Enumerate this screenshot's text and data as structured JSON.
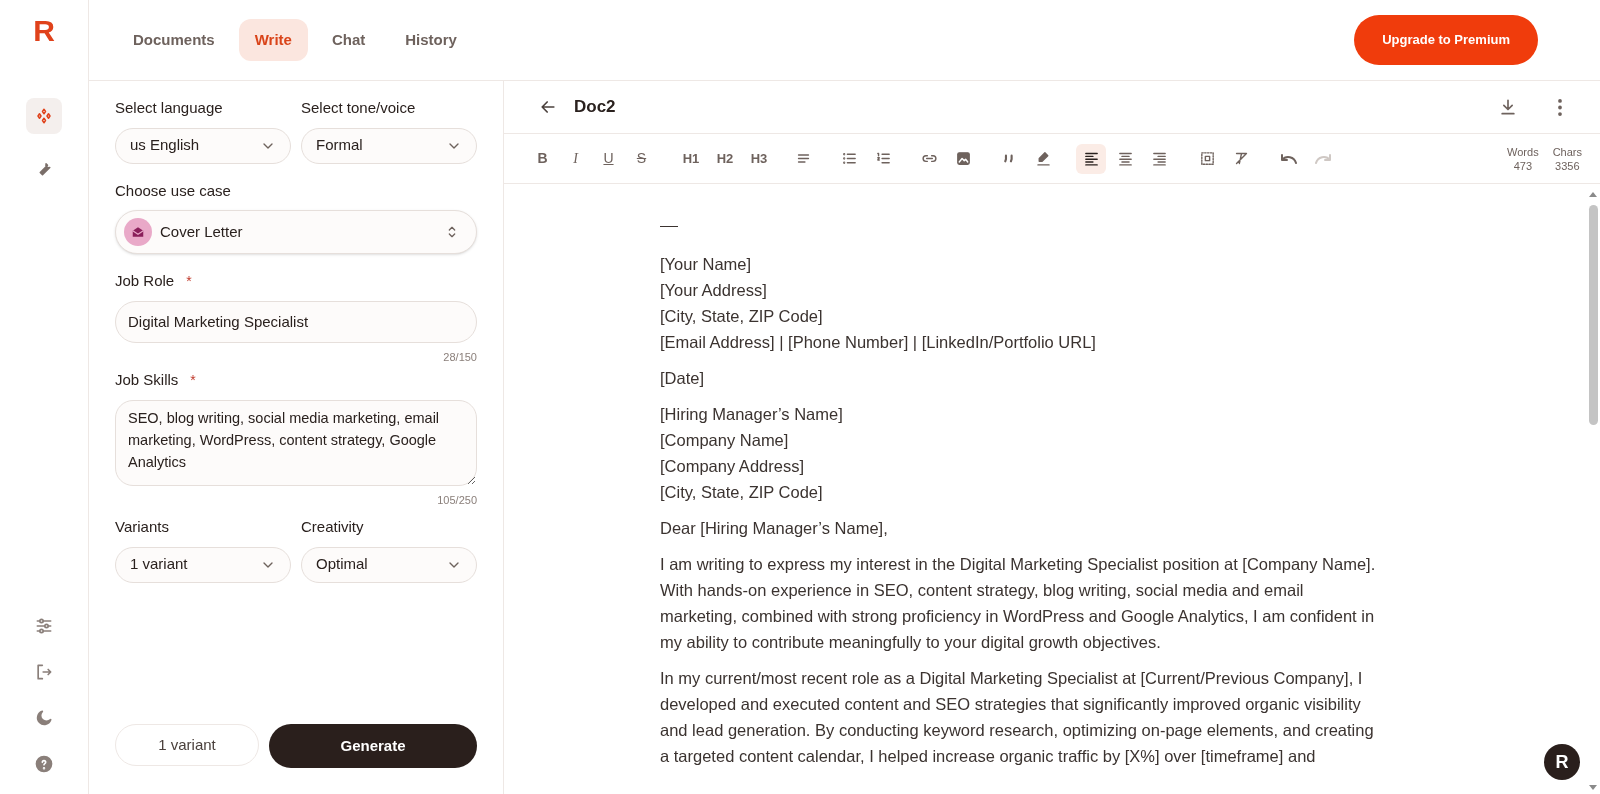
{
  "logo": {
    "text": "R"
  },
  "rail": {
    "items": [
      {
        "selected": true
      },
      {
        "selected": false
      }
    ]
  },
  "tabs": [
    {
      "label": "Documents",
      "selected": false
    },
    {
      "label": "Write",
      "selected": true
    },
    {
      "label": "Chat",
      "selected": false
    },
    {
      "label": "History",
      "selected": false
    }
  ],
  "upgrade_button": "Upgrade to Premium",
  "form": {
    "language": {
      "label": "Select language",
      "value": "us English"
    },
    "tone": {
      "label": "Select tone/voice",
      "value": "Formal"
    },
    "use_case": {
      "label": "Choose use case",
      "value": "Cover Letter"
    },
    "required_mark": "*",
    "job_role": {
      "label": "Job Role",
      "required": true,
      "value": "Digital Marketing Specialist",
      "counter": "28/150"
    },
    "job_skills": {
      "label": "Job Skills",
      "required": true,
      "value": "SEO, blog writing, social media marketing, email marketing, WordPress, content strategy, Google Analytics",
      "counter": "105/250"
    },
    "variants": {
      "label": "Variants",
      "value": "1 variant"
    },
    "creativity": {
      "label": "Creativity",
      "value": "Optimal"
    },
    "variant_button": "1 variant",
    "generate_button": "Generate"
  },
  "editor": {
    "title": "Doc2",
    "format_buttons": [
      "B",
      "I",
      "U",
      "S"
    ],
    "heading_buttons": [
      "H1",
      "H2",
      "H3"
    ],
    "tool_icons": [
      {
        "selected": false,
        "disabled": false
      },
      {
        "selected": false,
        "disabled": false
      },
      {
        "selected": false,
        "disabled": false
      },
      {
        "selected": false,
        "disabled": false
      },
      {
        "selected": false,
        "disabled": false
      },
      {
        "selected": false,
        "disabled": false
      },
      {
        "selected": false,
        "disabled": false
      },
      {
        "selected": true,
        "disabled": false
      },
      {
        "selected": false,
        "disabled": false
      },
      {
        "selected": false,
        "disabled": false
      },
      {
        "selected": false,
        "disabled": false
      },
      {
        "selected": false,
        "disabled": false
      },
      {
        "selected": false,
        "disabled": false
      },
      {
        "selected": false,
        "disabled": true
      }
    ],
    "stats": [
      {
        "label": "Words",
        "value": "473"
      },
      {
        "label": "Chars",
        "value": "3356"
      }
    ],
    "blocks": [
      {
        "kind": "rule"
      },
      {
        "kind": "lines",
        "lines": [
          "[Your Name]",
          "[Your Address]",
          "[City, State, ZIP Code]",
          "[Email Address] | [Phone Number] | [LinkedIn/Portfolio URL]"
        ]
      },
      {
        "kind": "lines",
        "lines": [
          "[Date]"
        ]
      },
      {
        "kind": "lines",
        "lines": [
          "[Hiring Manager’s Name]",
          "[Company Name]",
          "[Company Address]",
          "[City, State, ZIP Code]"
        ]
      },
      {
        "kind": "lines",
        "lines": [
          "Dear [Hiring Manager’s Name],"
        ]
      },
      {
        "kind": "lines",
        "lines": [
          "I am writing to express my interest in the Digital Marketing Specialist position at [Company Name].",
          "With hands-on experience in SEO, content strategy, blog writing, social media and email",
          "marketing, combined with strong proficiency in WordPress and Google Analytics, I am confident in",
          "my ability to contribute meaningfully to your digital growth objectives."
        ]
      },
      {
        "kind": "lines",
        "lines": [
          "In my current/most recent role as a Digital Marketing Specialist at [Current/Previous Company], I",
          "developed and executed content and SEO strategies that significantly improved organic visibility",
          "and lead generation. By conducting keyword research, optimizing on-page elements, and creating",
          "a targeted content calendar, I helped increase organic traffic by [X%] over [timeframe] and"
        ]
      }
    ]
  },
  "assistant_button": {
    "text": "R"
  }
}
